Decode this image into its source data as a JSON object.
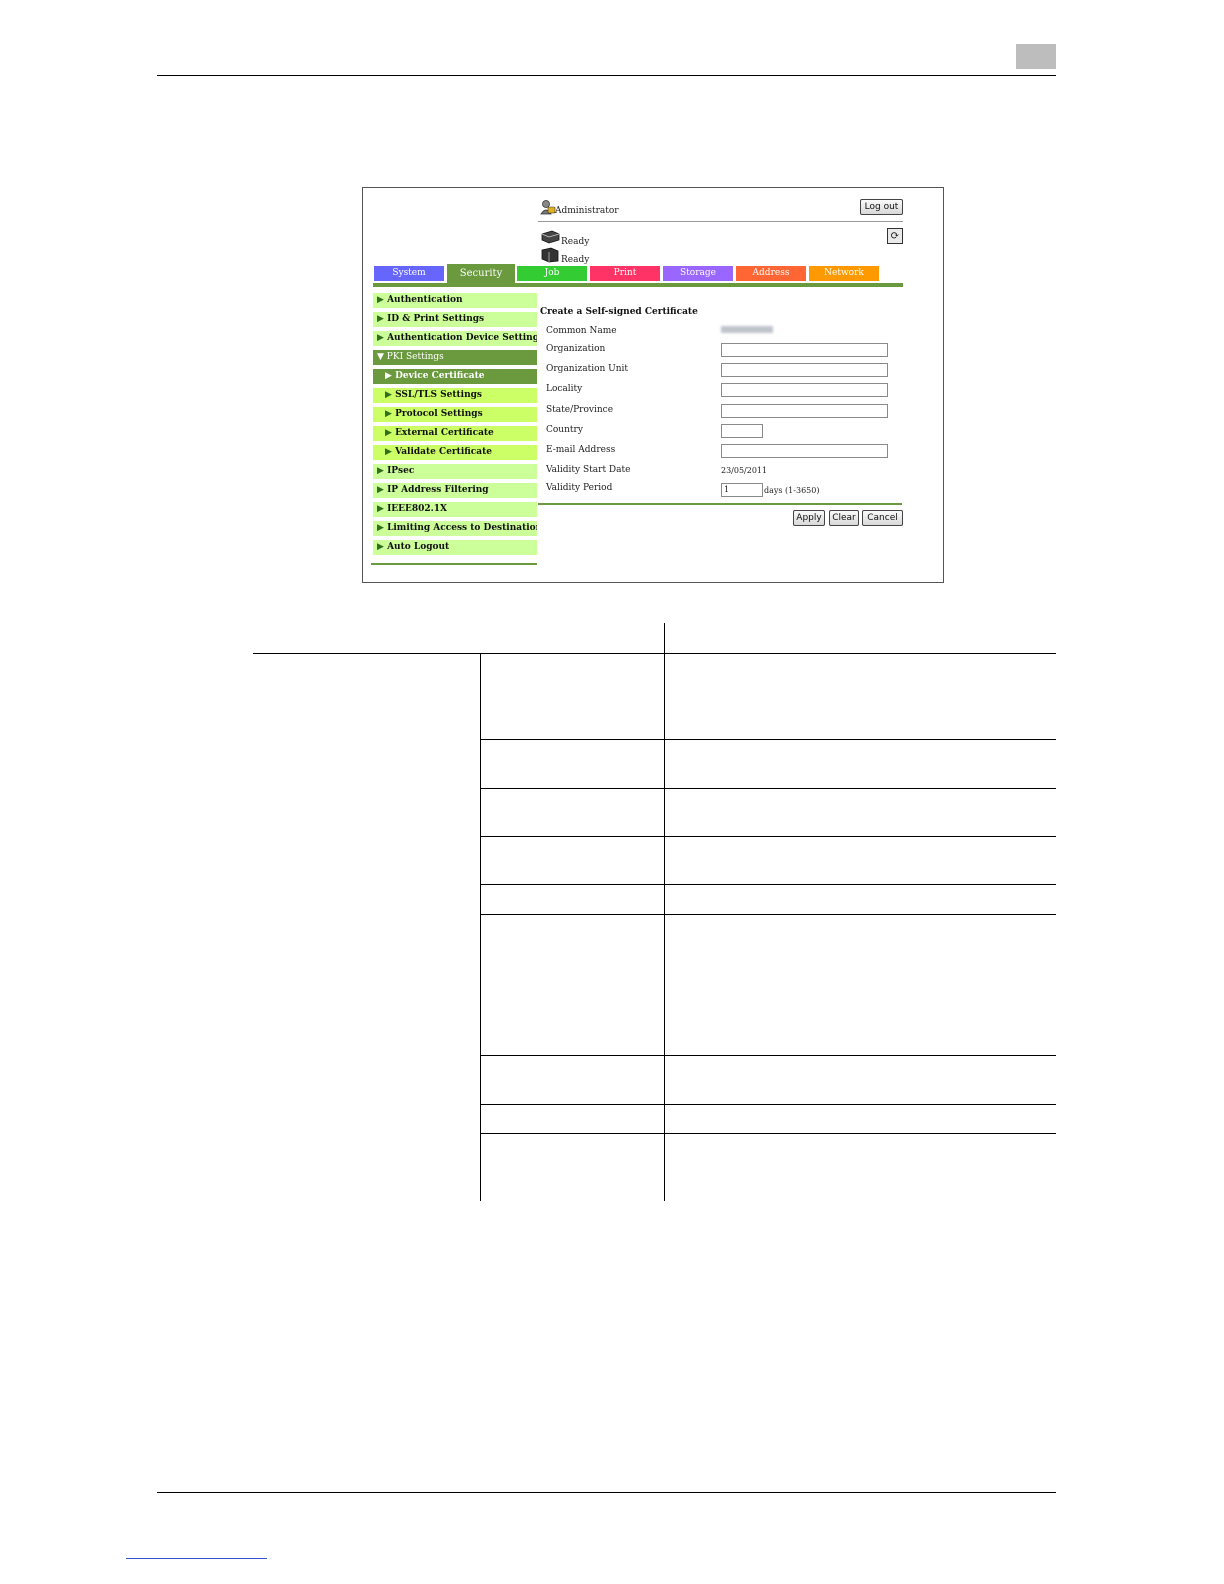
{
  "ui": {
    "admin_label": "Administrator",
    "logout_label": "Log out",
    "status1": "Ready",
    "status2": "Ready",
    "tabs": [
      {
        "label": "System",
        "color": "#6666ff"
      },
      {
        "label": "Security",
        "color": "#6b9a3e"
      },
      {
        "label": "Job",
        "color": "#33cc33"
      },
      {
        "label": "Print",
        "color": "#ff3366"
      },
      {
        "label": "Storage",
        "color": "#9966ff"
      },
      {
        "label": "Address",
        "color": "#ff6633"
      },
      {
        "label": "Network",
        "color": "#ff9900"
      }
    ],
    "sidebar": [
      {
        "label": "Authentication",
        "arrow": "▶"
      },
      {
        "label": "ID & Print Settings",
        "arrow": "▶"
      },
      {
        "label": "Authentication Device Settings",
        "arrow": "▶"
      },
      {
        "label": "PKI Settings",
        "arrow": "▼"
      },
      {
        "label": "Device Certificate",
        "arrow": "▶"
      },
      {
        "label": "SSL/TLS Settings",
        "arrow": "▶"
      },
      {
        "label": "Protocol Settings",
        "arrow": "▶"
      },
      {
        "label": "External Certificate",
        "arrow": "▶"
      },
      {
        "label": "Validate Certificate",
        "arrow": "▶"
      },
      {
        "label": "IPsec",
        "arrow": "▶"
      },
      {
        "label": "IP Address Filtering",
        "arrow": "▶"
      },
      {
        "label": "IEEE802.1X",
        "arrow": "▶"
      },
      {
        "label": "Limiting Access to Destination",
        "arrow": "▶"
      },
      {
        "label": "Auto Logout",
        "arrow": "▶"
      }
    ],
    "form": {
      "title": "Create a Self-signed Certificate",
      "labels": {
        "common_name": "Common Name",
        "organization": "Organization",
        "organization_unit": "Organization Unit",
        "locality": "Locality",
        "state": "State/Province",
        "country": "Country",
        "email": "E-mail Address",
        "validity_start": "Validity Start Date",
        "validity_period": "Validity Period"
      },
      "validity_start_value": "23/05/2011",
      "validity_period_value": "1",
      "validity_period_unit": "days (1-3650)"
    },
    "buttons": {
      "apply": "Apply",
      "clear": "Clear",
      "cancel": "Cancel"
    }
  }
}
